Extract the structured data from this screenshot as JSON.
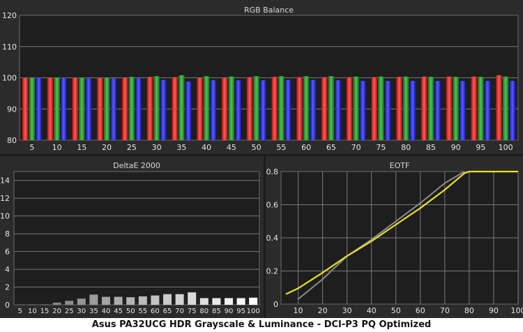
{
  "caption": "Asus PA32UCG HDR Grayscale & Luminance - DCI-P3 PQ Optimized",
  "colors": {
    "red": "#ff3b3b",
    "green": "#35b03a",
    "blue": "#3a3aff",
    "eotf_measured": "#e8e020",
    "eotf_target": "#8c8c8c",
    "gridline": "#7a7a7a"
  },
  "chart_data": [
    {
      "type": "bar",
      "title": "RGB Balance",
      "categories": [
        "5",
        "10",
        "15",
        "20",
        "25",
        "30",
        "35",
        "40",
        "45",
        "50",
        "55",
        "60",
        "65",
        "70",
        "75",
        "80",
        "85",
        "90",
        "95",
        "100"
      ],
      "series": [
        {
          "values": [
            100.0,
            100.0,
            100.0,
            100.0,
            100.0,
            100.3,
            100.2,
            100.0,
            100.0,
            100.2,
            100.3,
            100.2,
            100.2,
            100.2,
            100.2,
            100.3,
            100.4,
            100.4,
            100.4,
            100.8
          ]
        },
        {
          "values": [
            100.0,
            100.0,
            100.0,
            100.0,
            100.3,
            100.5,
            100.8,
            100.5,
            100.4,
            100.5,
            100.5,
            100.5,
            100.5,
            100.4,
            100.4,
            100.4,
            100.3,
            100.3,
            100.3,
            100.4
          ]
        },
        {
          "values": [
            100.0,
            100.0,
            99.8,
            99.8,
            99.8,
            99.3,
            98.8,
            99.2,
            99.2,
            99.2,
            99.3,
            99.3,
            99.2,
            99.0,
            99.0,
            99.0,
            99.0,
            99.0,
            99.0,
            99.0
          ]
        }
      ],
      "yticks": [
        80,
        90,
        100,
        110,
        120
      ],
      "ylim": [
        80,
        120
      ],
      "grid": true,
      "legend": "none"
    },
    {
      "type": "bar",
      "title": "DeltaE 2000",
      "categories": [
        "5",
        "10",
        "15",
        "20",
        "25",
        "30",
        "35",
        "40",
        "45",
        "50",
        "55",
        "60",
        "65",
        "70",
        "75",
        "80",
        "85",
        "90",
        "95",
        "100"
      ],
      "series": [
        {
          "values": [
            0.05,
            0.05,
            0.05,
            0.25,
            0.45,
            0.7,
            1.15,
            0.9,
            0.9,
            0.85,
            0.95,
            1.05,
            1.2,
            1.2,
            1.4,
            0.75,
            0.75,
            0.75,
            0.75,
            0.8
          ]
        }
      ],
      "yticks": [
        0,
        2,
        4,
        6,
        8,
        10,
        12,
        14
      ],
      "ylim": [
        0,
        15
      ],
      "grid": true,
      "legend": "none"
    },
    {
      "type": "line",
      "title": "EOTF",
      "x": [
        5,
        10,
        20,
        30,
        40,
        50,
        60,
        70,
        78,
        80,
        90,
        100
      ],
      "series": [
        {
          "values": [
            0.06,
            0.095,
            0.19,
            0.29,
            0.38,
            0.48,
            0.58,
            0.69,
            0.79,
            0.8,
            0.8,
            0.8
          ]
        },
        {
          "values": [
            null,
            0.03,
            0.15,
            0.29,
            0.39,
            0.5,
            0.61,
            0.73,
            0.8,
            null,
            null,
            null
          ]
        }
      ],
      "xticks": [
        10,
        20,
        30,
        40,
        50,
        60,
        70,
        80,
        90,
        100
      ],
      "yticks": [
        0,
        0.2,
        0.4,
        0.6,
        0.8
      ],
      "xlim": [
        3,
        100
      ],
      "ylim": [
        0,
        0.8
      ],
      "grid": true,
      "legend": "none"
    }
  ]
}
